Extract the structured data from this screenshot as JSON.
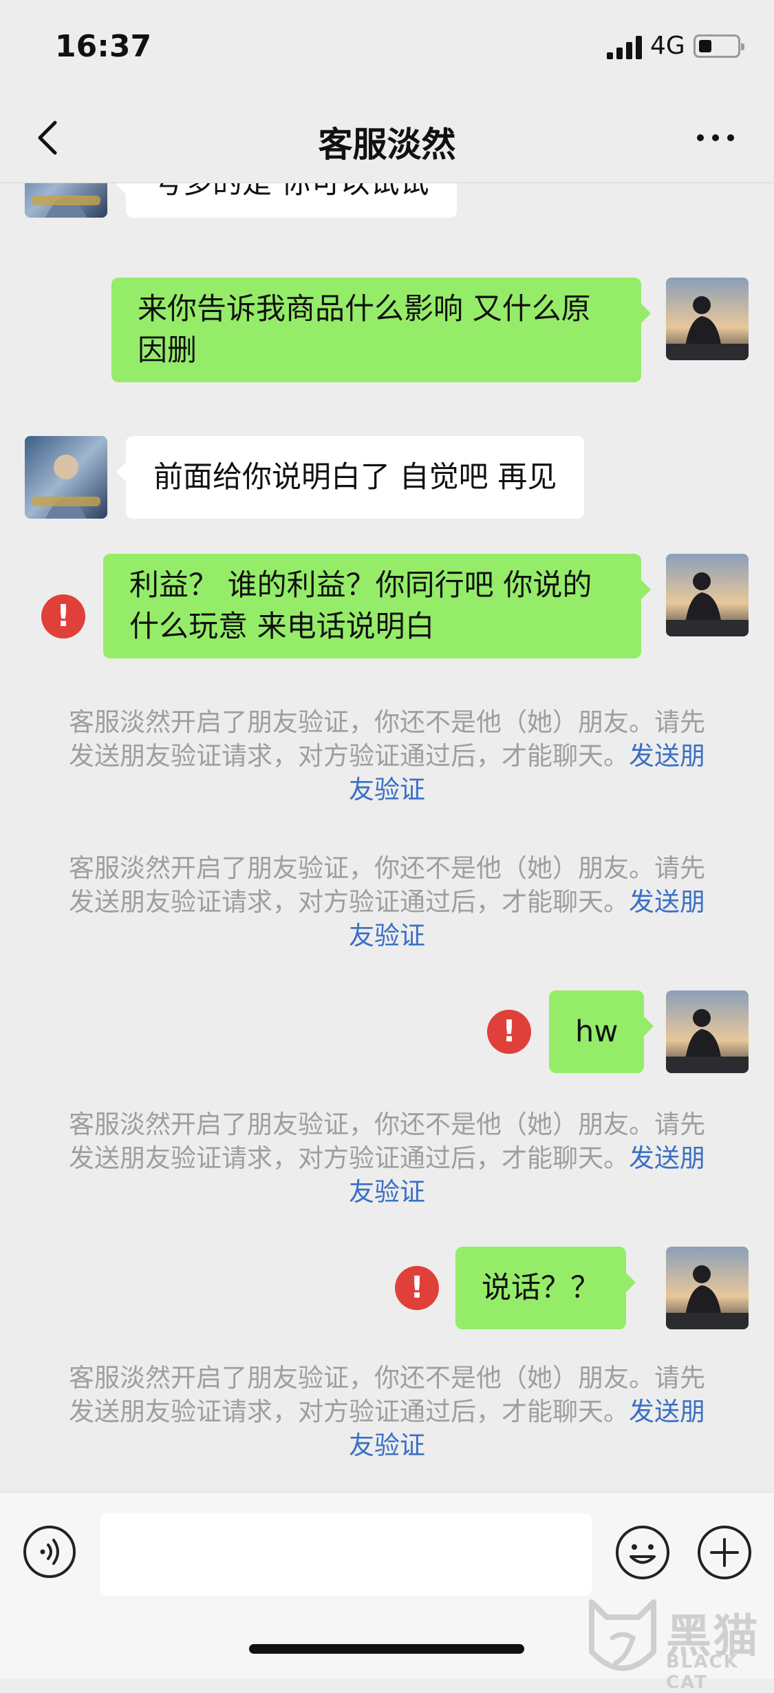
{
  "status_bar": {
    "time": "16:37",
    "network": "4G"
  },
  "nav": {
    "title": "客服淡然"
  },
  "messages": [
    {
      "type": "in",
      "text": "号多的是 你可以试试"
    },
    {
      "type": "out",
      "text": "来你告诉我商品什么影响 又什么原因删"
    },
    {
      "type": "in",
      "text": "前面给你说明白了 自觉吧 再见"
    },
    {
      "type": "out",
      "text": "利益？ 谁的利益？你同行吧 你说的什么玩意 来电话说明白",
      "failed": true
    },
    {
      "type": "system",
      "text": "客服淡然开启了朋友验证，你还不是他（她）朋友。请先发送朋友验证请求，对方验证通过后，才能聊天。",
      "link": "发送朋友验证"
    },
    {
      "type": "system",
      "text": "客服淡然开启了朋友验证，你还不是他（她）朋友。请先发送朋友验证请求，对方验证通过后，才能聊天。",
      "link": "发送朋友验证"
    },
    {
      "type": "out",
      "text": "hw",
      "failed": true
    },
    {
      "type": "system",
      "text": "客服淡然开启了朋友验证，你还不是他（她）朋友。请先发送朋友验证请求，对方验证通过后，才能聊天。",
      "link": "发送朋友验证"
    },
    {
      "type": "out",
      "text": "说话？？",
      "failed": true
    },
    {
      "type": "system",
      "text": "客服淡然开启了朋友验证，你还不是他（她）朋友。请先发送朋友验证请求，对方验证通过后，才能聊天。",
      "link": "发送朋友验证"
    }
  ],
  "alert_glyph": "!",
  "icons": {
    "back": "chevron-left-icon",
    "more": "more-dots-icon",
    "voice": "voice-icon",
    "emoji": "emoji-icon",
    "plus": "plus-icon",
    "alert": "alert-icon"
  },
  "colors": {
    "out_bubble": "#95ec69",
    "in_bubble": "#ffffff",
    "alert": "#e0403a",
    "link": "#3a6fc4",
    "system_text": "#9e9e9e"
  },
  "watermark": {
    "cn": "黑猫",
    "en": "BLACK CAT"
  }
}
